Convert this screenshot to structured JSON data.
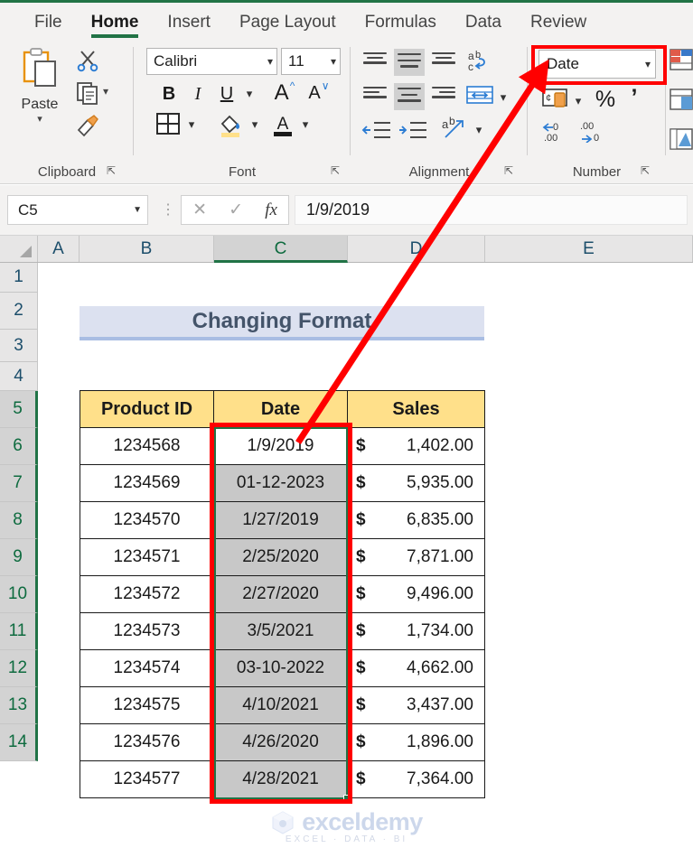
{
  "ribbon": {
    "tabs": [
      {
        "label": "File",
        "active": false
      },
      {
        "label": "Home",
        "active": true
      },
      {
        "label": "Insert",
        "active": false
      },
      {
        "label": "Page Layout",
        "active": false
      },
      {
        "label": "Formulas",
        "active": false
      },
      {
        "label": "Data",
        "active": false
      },
      {
        "label": "Review",
        "active": false
      }
    ],
    "groups": {
      "clipboard": {
        "label": "Clipboard",
        "paste_label": "Paste",
        "icons": [
          "paste-icon",
          "cut-scissors-icon",
          "copy-icon",
          "format-painter-icon"
        ]
      },
      "font": {
        "label": "Font",
        "font_name": "Calibri",
        "font_size": "11",
        "bold_label": "B",
        "italic_label": "I",
        "underline_label": "U",
        "grow_font_label": "A",
        "shrink_font_label": "A",
        "icons": [
          "borders-icon",
          "fill-color-icon",
          "font-color-icon"
        ]
      },
      "alignment": {
        "label": "Alignment",
        "icons": [
          "align-top-icon",
          "align-middle-icon",
          "align-bottom-icon",
          "wrap-text-icon",
          "align-left-icon",
          "align-center-icon",
          "align-right-icon",
          "merge-center-icon",
          "decrease-indent-icon",
          "increase-indent-icon",
          "orientation-icon"
        ]
      },
      "number": {
        "label": "Number",
        "format_value": "Date",
        "accounting_label": "accounting-format-icon",
        "percent_label": "%",
        "comma_label": "’",
        "increase_decimal_label": "increase-decimal-icon",
        "decrease_decimal_label": "decrease-decimal-icon"
      },
      "styles": {
        "icons": [
          "conditional-formatting-icon",
          "format-as-table-icon",
          "cell-styles-icon"
        ]
      }
    }
  },
  "formula_bar": {
    "name_box": "C5",
    "cancel_icon": "✕",
    "confirm_icon": "✓",
    "function_icon": "fx",
    "value": "1/9/2019"
  },
  "grid": {
    "columns": [
      "A",
      "B",
      "C",
      "D",
      "E"
    ],
    "selected_column": "C",
    "rows": [
      "1",
      "2",
      "3",
      "4",
      "5",
      "6",
      "7",
      "8",
      "9",
      "10",
      "11",
      "12",
      "13",
      "14"
    ],
    "selected_rows": [
      "5",
      "6",
      "7",
      "8",
      "9",
      "10",
      "11",
      "12",
      "13",
      "14"
    ]
  },
  "sheet": {
    "title": "Changing Format",
    "table": {
      "headers": [
        "Product ID",
        "Date",
        "Sales"
      ],
      "rows": [
        {
          "id": "1234568",
          "date": "1/9/2019",
          "currency": "$",
          "sales": "1,402.00"
        },
        {
          "id": "1234569",
          "date": "01-12-2023",
          "currency": "$",
          "sales": "5,935.00"
        },
        {
          "id": "1234570",
          "date": "1/27/2019",
          "currency": "$",
          "sales": "6,835.00"
        },
        {
          "id": "1234571",
          "date": "2/25/2020",
          "currency": "$",
          "sales": "7,871.00"
        },
        {
          "id": "1234572",
          "date": "2/27/2020",
          "currency": "$",
          "sales": "9,496.00"
        },
        {
          "id": "1234573",
          "date": "3/5/2021",
          "currency": "$",
          "sales": "1,734.00"
        },
        {
          "id": "1234574",
          "date": "03-10-2022",
          "currency": "$",
          "sales": "4,662.00"
        },
        {
          "id": "1234575",
          "date": "4/10/2021",
          "currency": "$",
          "sales": "3,437.00"
        },
        {
          "id": "1234576",
          "date": "4/26/2020",
          "currency": "$",
          "sales": "1,896.00"
        },
        {
          "id": "1234577",
          "date": "4/28/2021",
          "currency": "$",
          "sales": "7,364.00"
        }
      ]
    }
  },
  "watermark": {
    "brand": "exceldemy",
    "tagline": "EXCEL  ·  DATA  ·  BI"
  },
  "colors": {
    "excel_green": "#217346",
    "annotation_red": "#ff0000",
    "header_gold": "#ffe08a",
    "title_band": "#dce1f0",
    "selection_shade": "#c8c8c8"
  }
}
